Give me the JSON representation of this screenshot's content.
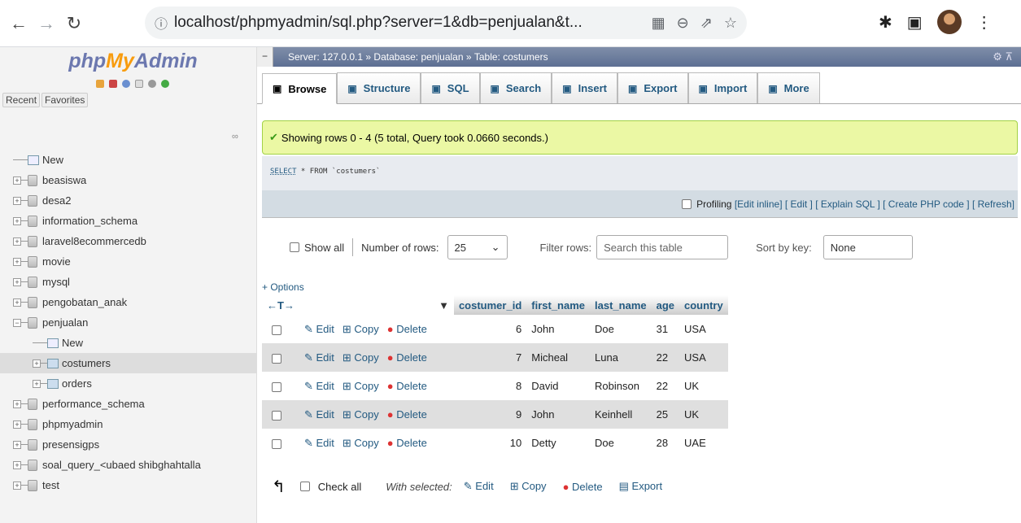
{
  "browser": {
    "url": "localhost/phpmyadmin/sql.php?server=1&db=penjualan&t..."
  },
  "logo": {
    "php": "php",
    "my": "My",
    "admin": "Admin"
  },
  "nav_tabs": {
    "recent": "Recent",
    "favorites": "Favorites"
  },
  "tree": [
    {
      "label": "New",
      "type": "new",
      "indent": 0
    },
    {
      "label": "beasiswa",
      "type": "db",
      "indent": 0
    },
    {
      "label": "desa2",
      "type": "db",
      "indent": 0
    },
    {
      "label": "information_schema",
      "type": "db",
      "indent": 0
    },
    {
      "label": "laravel8ecommercedb",
      "type": "db",
      "indent": 0
    },
    {
      "label": "movie",
      "type": "db",
      "indent": 0
    },
    {
      "label": "mysql",
      "type": "db",
      "indent": 0
    },
    {
      "label": "pengobatan_anak",
      "type": "db",
      "indent": 0
    },
    {
      "label": "penjualan",
      "type": "db",
      "indent": 0,
      "expanded": true
    },
    {
      "label": "New",
      "type": "new",
      "indent": 1
    },
    {
      "label": "costumers",
      "type": "table",
      "indent": 1,
      "selected": true
    },
    {
      "label": "orders",
      "type": "table",
      "indent": 1
    },
    {
      "label": "performance_schema",
      "type": "db",
      "indent": 0
    },
    {
      "label": "phpmyadmin",
      "type": "db",
      "indent": 0
    },
    {
      "label": "presensigps",
      "type": "db",
      "indent": 0
    },
    {
      "label": "soal_query_<ubaed shibghahtalla",
      "type": "db",
      "indent": 0
    },
    {
      "label": "test",
      "type": "db",
      "indent": 0
    }
  ],
  "breadcrumb": {
    "server": "Server: 127.0.0.1 »",
    "database": "Database: penjualan »",
    "table": "Table: costumers"
  },
  "menu": [
    {
      "label": "Browse",
      "icon": "browse-icon",
      "active": true
    },
    {
      "label": "Structure",
      "icon": "structure-icon"
    },
    {
      "label": "SQL",
      "icon": "sql-icon"
    },
    {
      "label": "Search",
      "icon": "search-icon"
    },
    {
      "label": "Insert",
      "icon": "insert-icon"
    },
    {
      "label": "Export",
      "icon": "export-icon"
    },
    {
      "label": "Import",
      "icon": "import-icon"
    },
    {
      "label": "More",
      "icon": "chevron-down-icon"
    }
  ],
  "success_message": "Showing rows 0 - 4 (5 total, Query took 0.0660 seconds.)",
  "sql": {
    "kw": "SELECT",
    "rest": " * FROM `costumers`"
  },
  "profiling": {
    "label": "Profiling",
    "links": "[Edit inline] [ Edit ] [ Explain SQL ] [ Create PHP code ] [ Refresh]"
  },
  "controls": {
    "show_all": "Show all",
    "rows_label": "Number of rows:",
    "rows_value": "25",
    "filter_label": "Filter rows:",
    "filter_placeholder": "Search this table",
    "sort_label": "Sort by key:",
    "sort_value": "None"
  },
  "options_label": "+ Options",
  "columns": [
    "costumer_id",
    "first_name",
    "last_name",
    "age",
    "country"
  ],
  "actions": {
    "edit": "Edit",
    "copy": "Copy",
    "delete": "Delete"
  },
  "rows": [
    [
      "6",
      "John",
      "Doe",
      "31",
      "USA"
    ],
    [
      "7",
      "Micheal",
      "Luna",
      "22",
      "USA"
    ],
    [
      "8",
      "David",
      "Robinson",
      "22",
      "UK"
    ],
    [
      "9",
      "John",
      "Keinhell",
      "25",
      "UK"
    ],
    [
      "10",
      "Detty",
      "Doe",
      "28",
      "UAE"
    ]
  ],
  "footer": {
    "check_all": "Check all",
    "with_selected": "With selected:",
    "edit": "Edit",
    "copy": "Copy",
    "delete": "Delete",
    "export": "Export"
  }
}
